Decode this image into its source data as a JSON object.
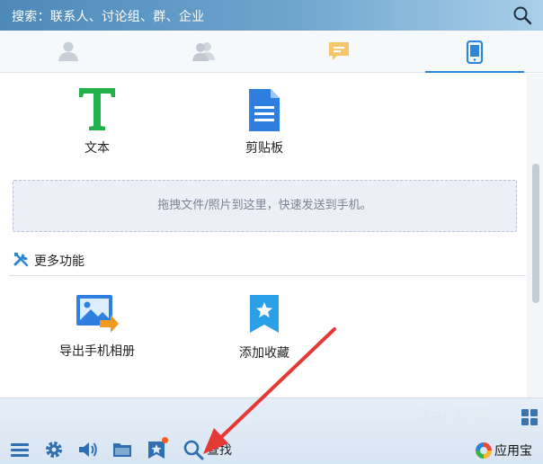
{
  "search": {
    "placeholder_text": "搜索：联系人、讨论组、群、企业",
    "icon": "search-icon"
  },
  "tabs": [
    {
      "name": "contacts",
      "icon": "person-icon",
      "active": false
    },
    {
      "name": "groups",
      "icon": "people-icon",
      "active": false
    },
    {
      "name": "conversations",
      "icon": "message-icon",
      "active": false
    },
    {
      "name": "device",
      "icon": "phone-icon",
      "active": true
    }
  ],
  "apps": [
    {
      "label": "文本",
      "icon": "text-t-icon"
    },
    {
      "label": "剪贴板",
      "icon": "document-icon"
    }
  ],
  "dropzone": {
    "text": "拖拽文件/照片到这里，快速发送到手机。"
  },
  "more": {
    "title": "更多功能",
    "icon": "tools-icon"
  },
  "more_apps": [
    {
      "label": "导出手机相册",
      "icon": "photo-export-icon"
    },
    {
      "label": "添加收藏",
      "icon": "bookmark-star-icon"
    }
  ],
  "toolbar": {
    "icons": [
      "menu-icon",
      "gear-icon",
      "speaker-icon",
      "folder-icon",
      "star-icon",
      "search-icon"
    ],
    "find_label": "查找",
    "appstore_label": "应用宝"
  },
  "watermark": {
    "brand": "Bai 经验",
    "domain": "jingyan.baidu.com"
  },
  "colors": {
    "accent": "#2d86d6",
    "header": "#5a95c3",
    "text_green": "#22b24c",
    "arrow": "#e53935"
  }
}
